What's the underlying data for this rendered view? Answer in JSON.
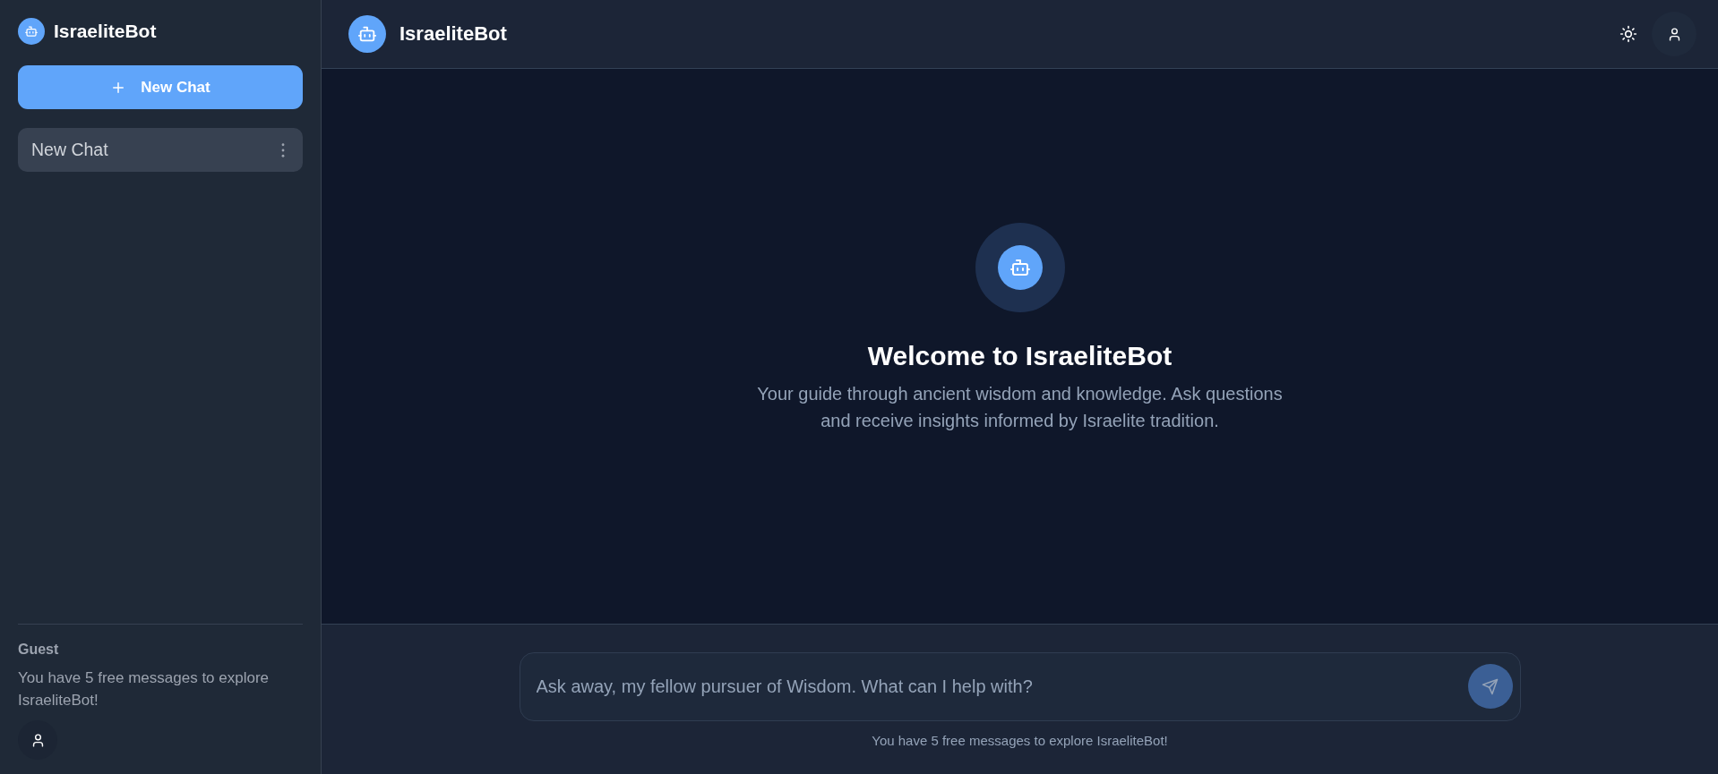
{
  "sidebar": {
    "brand": {
      "title": "IsraeliteBot"
    },
    "new_chat_button": {
      "label": "New Chat"
    },
    "chats": [
      {
        "title": "New Chat",
        "selected": true
      }
    ],
    "footer": {
      "user_name": "Guest",
      "message": "You have 5 free messages to explore IsraeliteBot!"
    }
  },
  "header": {
    "title": "IsraeliteBot"
  },
  "welcome": {
    "heading": "Welcome to IsraeliteBot",
    "text": "Your guide through ancient wisdom and knowledge. Ask questions and receive insights informed by Israelite tradition."
  },
  "composer": {
    "placeholder": "Ask away, my fellow pursuer of Wisdom. What can I help with?",
    "send_button": {
      "disabled": true
    },
    "note": "You have 5 free messages to explore IsraeliteBot!"
  }
}
